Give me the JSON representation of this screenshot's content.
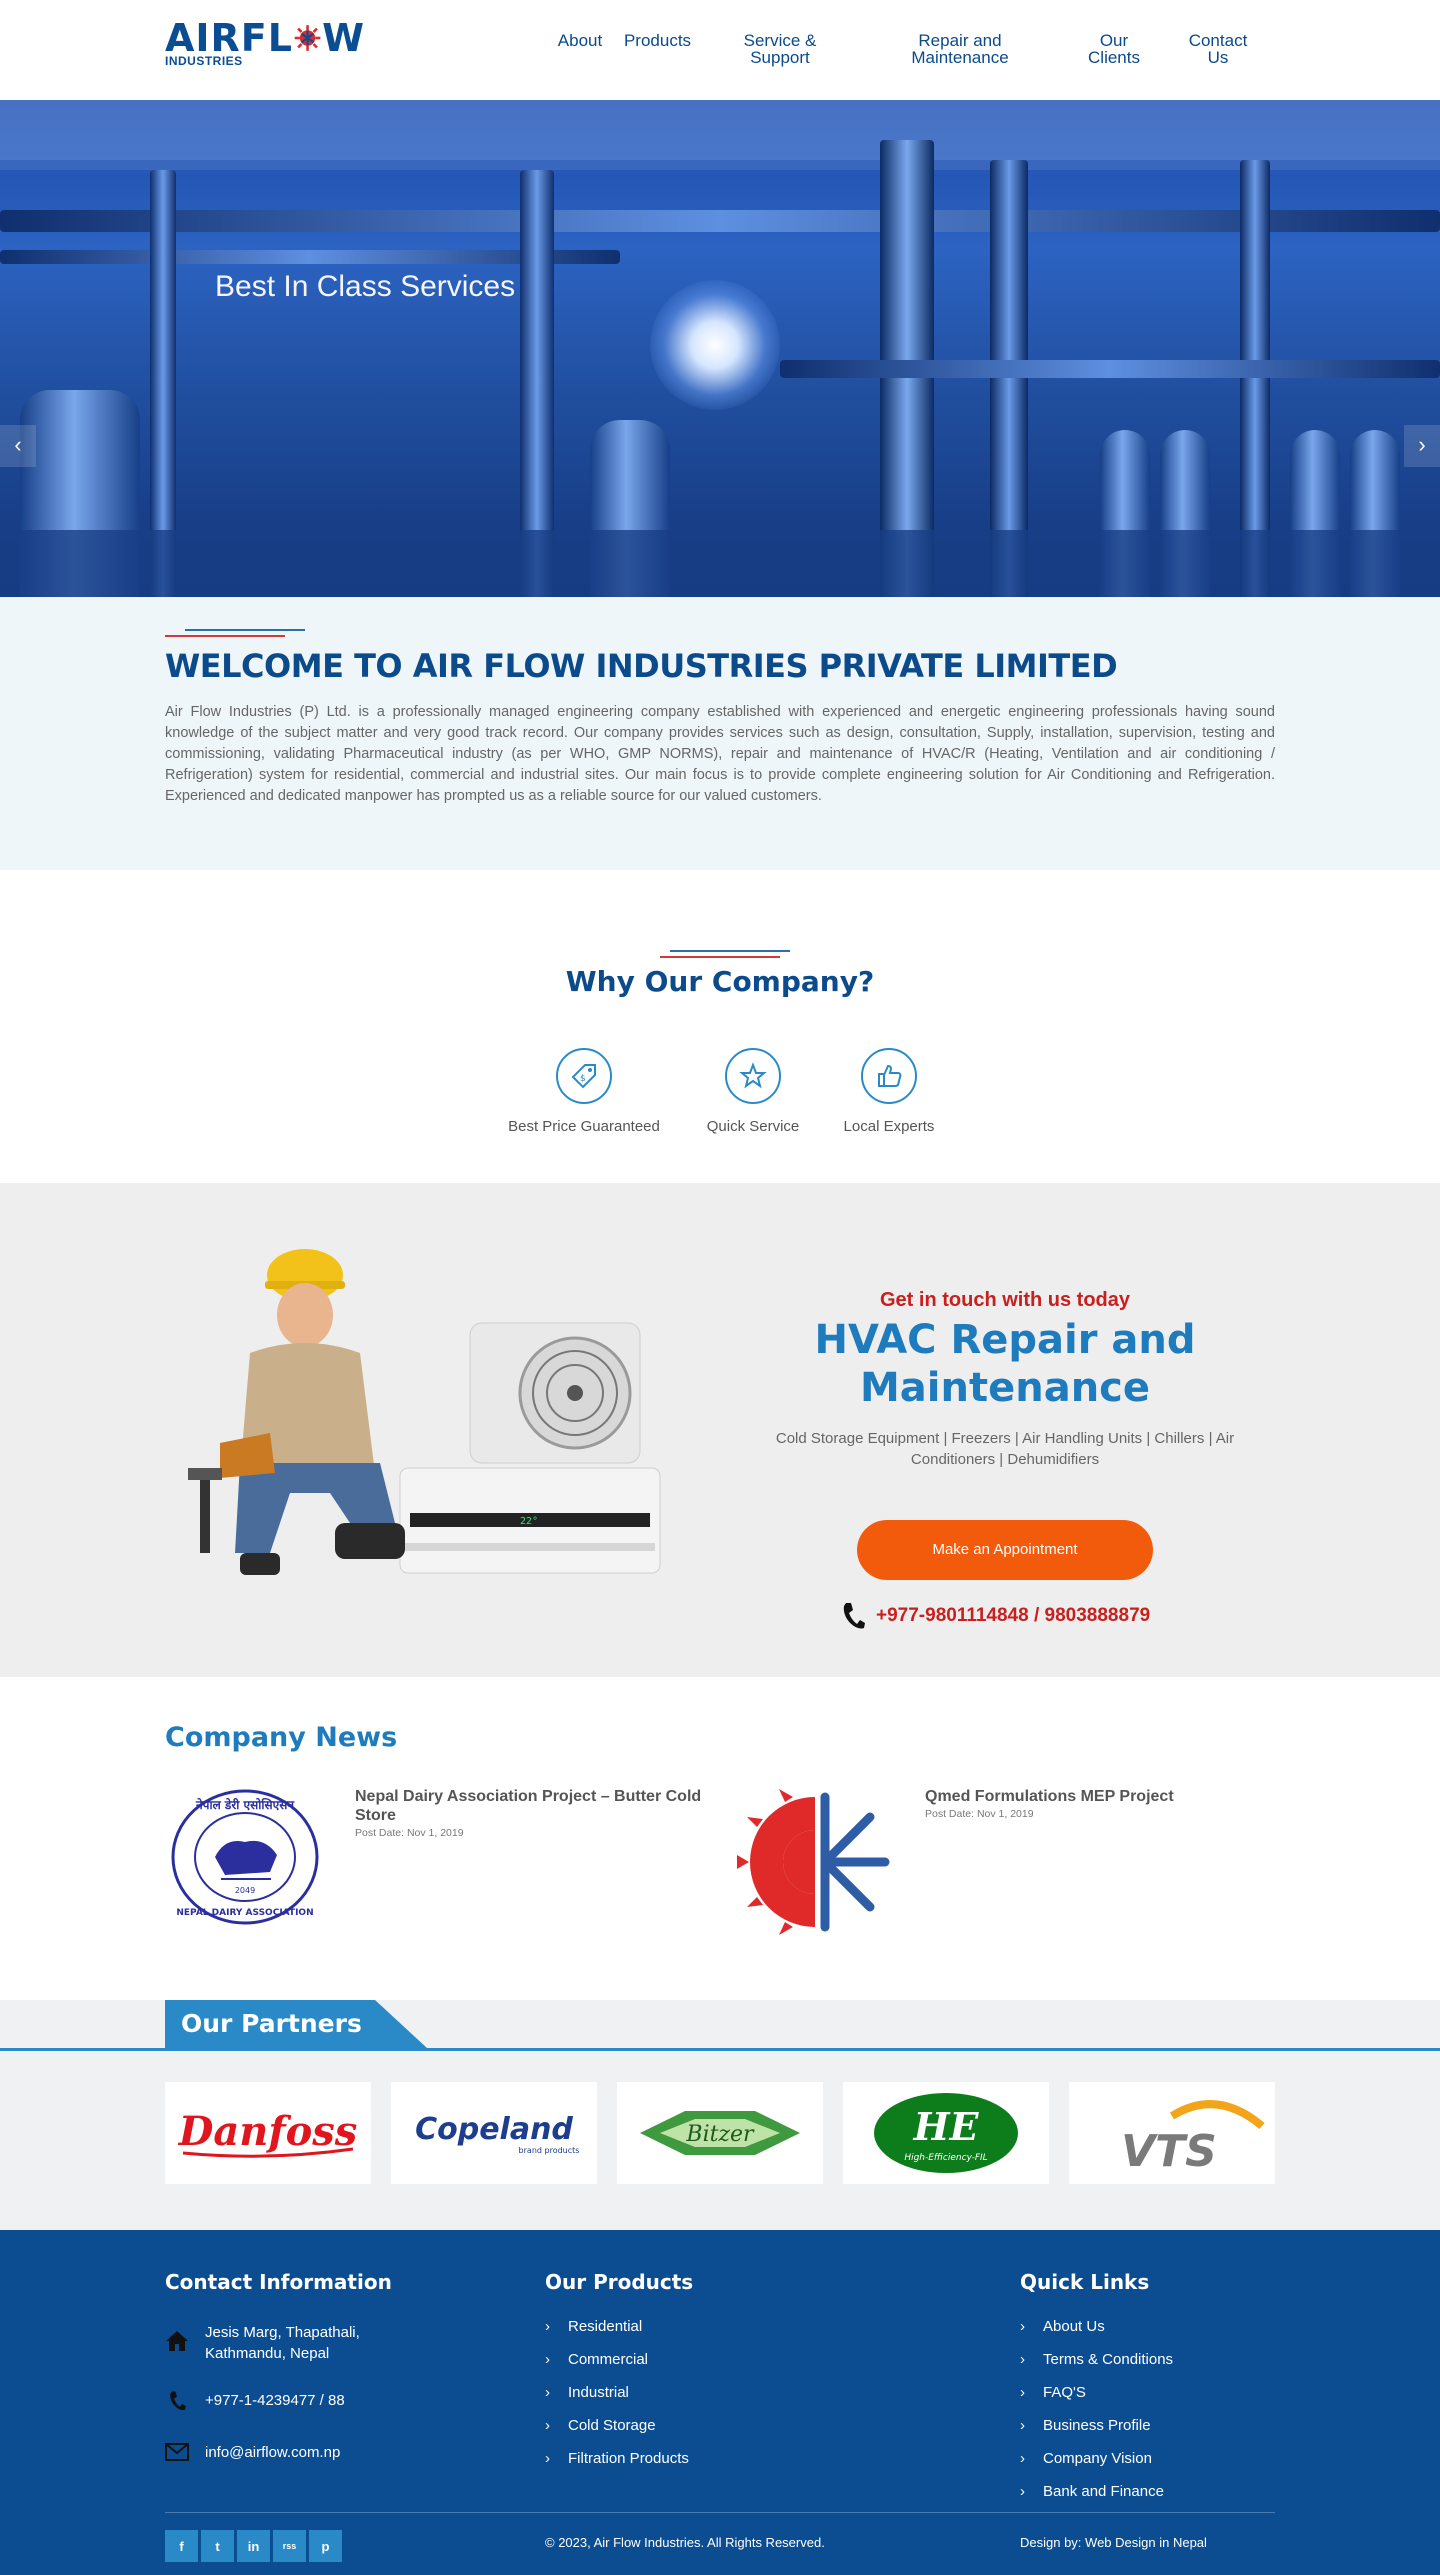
{
  "header": {
    "logo_text_left": "AIRFL",
    "logo_text_right": "W",
    "logo_sub": "INDUSTRIES",
    "nav": [
      {
        "line1": "About",
        "line2": ""
      },
      {
        "line1": "Products",
        "line2": ""
      },
      {
        "line1": "Service &",
        "line2": "Support"
      },
      {
        "line1": "Repair and",
        "line2": "Maintenance"
      },
      {
        "line1": "Our",
        "line2": "Clients"
      },
      {
        "line1": "Contact",
        "line2": "Us"
      }
    ]
  },
  "hero": {
    "title": "Best In Class Services",
    "prev": "‹",
    "next": "›"
  },
  "welcome": {
    "heading": "WELCOME TO AIR FLOW INDUSTRIES PRIVATE LIMITED",
    "body": "Air Flow Industries (P) Ltd. is a professionally managed engineering company established with experienced and energetic engineering professionals having sound knowledge of the subject matter and very good track record. Our company provides services such as design, consultation, Supply, installation, supervision, testing and commissioning, validating Pharmaceutical industry (as per WHO, GMP NORMS), repair and maintenance of HVAC/R (Heating, Ventilation and air conditioning / Refrigeration) system for residential, commercial and industrial sites. Our main focus is to provide complete engineering solution for Air Conditioning and Refrigeration. Experienced and dedicated manpower has prompted us as a reliable source for our valued customers."
  },
  "why": {
    "heading": "Why Our Company?",
    "features": [
      {
        "label": "Best Price Guaranteed",
        "icon": "price-tag-icon"
      },
      {
        "label": "Quick Service",
        "icon": "star-icon"
      },
      {
        "label": "Local Experts",
        "icon": "thumbs-up-icon"
      }
    ]
  },
  "hvac": {
    "tagline": "Get in touch with us today",
    "heading_line1": "HVAC Repair and",
    "heading_line2": "Maintenance",
    "subtext": "Cold Storage Equipment | Freezers | Air Handling Units | Chillers | Air Conditioners | Dehumidifiers",
    "button": "Make an Appointment",
    "phone": "+977-9801114848 / 9803888879",
    "ac_display": "22°"
  },
  "news": {
    "heading": "Company News",
    "items": [
      {
        "title": "Nepal Dairy Association Project – Butter Cold Store",
        "date": "Post Date: Nov 1, 2019",
        "logo_top": "नेपाल डेरी एसोसिएसन",
        "logo_bottom": "NEPAL DAIRY ASSOCIATION",
        "logo_mid": "2049"
      },
      {
        "title": "Qmed Formulations MEP Project",
        "date": "Post Date: Nov 1, 2019"
      }
    ]
  },
  "partners": {
    "heading": "Our Partners",
    "logos": [
      {
        "name": "Danfoss"
      },
      {
        "name": "Copeland",
        "sub": "brand products"
      },
      {
        "name": "Bitzer"
      },
      {
        "name": "HE",
        "sub": "High-Efficiency-FIL"
      },
      {
        "name": "VTS"
      }
    ]
  },
  "footer": {
    "contact_heading": "Contact Information",
    "address_line1": "Jesis Marg, Thapathali,",
    "address_line2": "Kathmandu, Nepal",
    "phone": "+977-1-4239477 / 88",
    "email": "info@airflow.com.np",
    "products_heading": "Our Products",
    "products": [
      "Residential",
      "Commercial",
      "Industrial",
      "Cold Storage",
      "Filtration Products"
    ],
    "links_heading": "Quick Links",
    "links": [
      "About Us",
      "Terms & Conditions",
      "FAQ'S",
      "Business Profile",
      "Company Vision",
      "Bank and Finance"
    ],
    "copyright": "© 2023, Air Flow Industries. All Rights Reserved.",
    "design_credit": "Design by: Web Design in Nepal",
    "social": [
      "f",
      "t",
      "in",
      "rss",
      "p"
    ]
  },
  "colors": {
    "primary": "#0b4a8b",
    "accent": "#1e7bbd",
    "orange": "#f35b0c",
    "red": "#c8201e",
    "footer": "#0c4d92"
  }
}
